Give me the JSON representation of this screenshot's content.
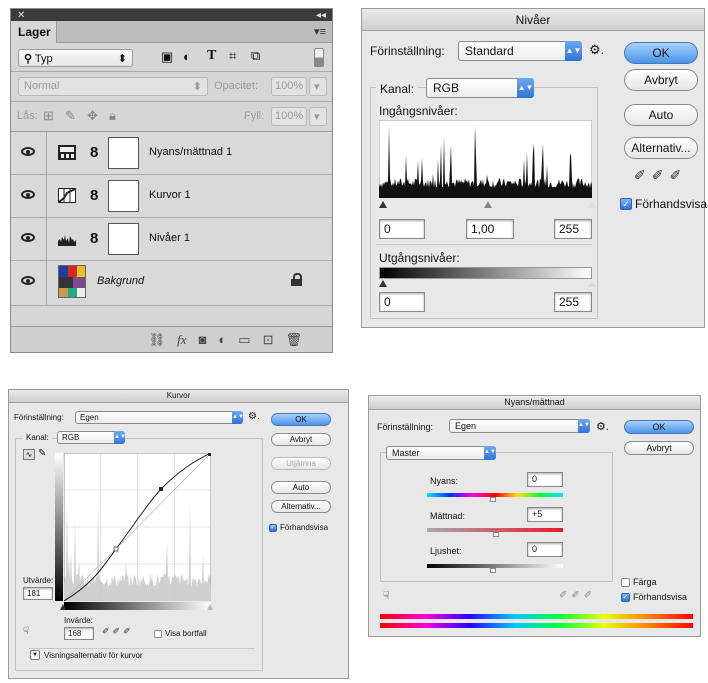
{
  "layers_panel": {
    "tab": "Lager",
    "filter_kind": "Typ",
    "blend_mode": "Normal",
    "opacity_label": "Opacitet:",
    "opacity_value": "100%",
    "lock_label": "Lås:",
    "fill_label": "Fyll:",
    "fill_value": "100%",
    "layers": [
      {
        "name": "Nyans/mättnad 1",
        "icon": "hue-saturation-icon"
      },
      {
        "name": "Kurvor 1",
        "icon": "curves-icon"
      },
      {
        "name": "Nivåer 1",
        "icon": "levels-icon"
      },
      {
        "name": "Bakgrund",
        "icon": "image-thumbnail",
        "locked": true
      }
    ]
  },
  "levels_dialog": {
    "title": "Nivåer",
    "preset_label": "Förinställning:",
    "preset_value": "Standard",
    "channel_label": "Kanal:",
    "channel_value": "RGB",
    "input_levels_label": "Ingångsnivåer:",
    "input_black": "0",
    "input_gamma": "1,00",
    "input_white": "255",
    "output_levels_label": "Utgångsnivåer:",
    "output_black": "0",
    "output_white": "255",
    "ok": "OK",
    "cancel": "Avbryt",
    "auto": "Auto",
    "options": "Alternativ...",
    "preview": "Förhandsvisa",
    "preview_checked": true
  },
  "curves_dialog": {
    "title": "Kurvor",
    "preset_label": "Förinställning:",
    "preset_value": "Egen",
    "channel_label": "Kanal:",
    "channel_value": "RGB",
    "ok": "OK",
    "cancel": "Avbryt",
    "smooth": "Utjämna",
    "auto": "Auto",
    "options": "Alternativ...",
    "preview": "Förhandsvisa",
    "preview_checked": true,
    "output_label": "Utvärde:",
    "output_value": "181",
    "input_label": "Invärde:",
    "input_value": "168",
    "show_clipping": "Visa bortfall",
    "display_options": "Visningsalternativ för kurvor"
  },
  "huesat_dialog": {
    "title": "Nyans/mättnad",
    "preset_label": "Förinställning:",
    "preset_value": "Egen",
    "range_value": "Master",
    "ok": "OK",
    "cancel": "Avbryt",
    "hue_label": "Nyans:",
    "hue_value": "0",
    "saturation_label": "Mättnad:",
    "saturation_value": "+5",
    "lightness_label": "Ljushet:",
    "lightness_value": "0",
    "colorize": "Färga",
    "colorize_checked": false,
    "preview": "Förhandsvisa",
    "preview_checked": true
  },
  "colors": {
    "accent_blue": "#2f73d8",
    "panel_grey": "#d6d6d6",
    "dialog_grey": "#e8e8e8"
  }
}
